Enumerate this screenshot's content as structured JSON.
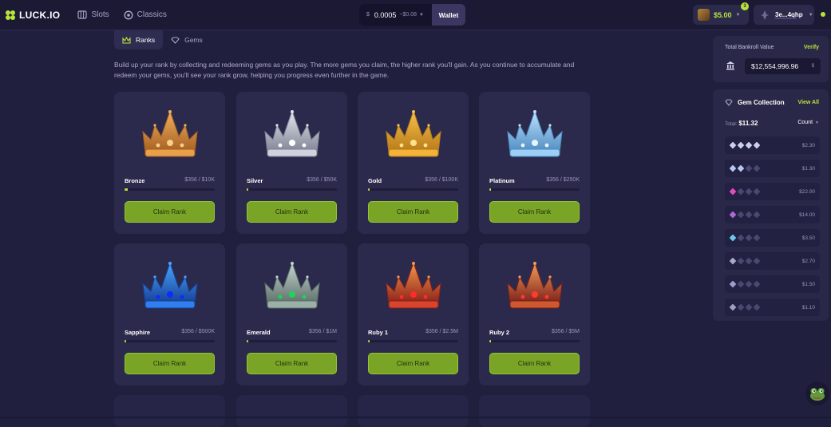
{
  "brand": {
    "name": "LUCK.IO",
    "accent": "#b8e33b"
  },
  "nav": {
    "slots": "Slots",
    "classics": "Classics"
  },
  "wallet": {
    "currency": "$",
    "balance": "0.0005",
    "delta": "~$0.08",
    "button": "Wallet"
  },
  "header": {
    "balance": "$5.00",
    "notifications": "3",
    "username": "3e...4qhp"
  },
  "tabs": [
    {
      "label": "Ranks",
      "active": true
    },
    {
      "label": "Gems",
      "active": false
    }
  ],
  "intro": "Build up your rank by collecting and redeeming gems as you play. The more gems you claim, the higher rank you'll gain. As you continue to accumulate and redeem your gems, you'll see your rank grow, helping you progress even further in the game.",
  "ranks": [
    {
      "name": "Bronze",
      "progress": "$356 / $10K",
      "fraction": 0.036,
      "color": "bronze",
      "claim": "Claim Rank"
    },
    {
      "name": "Silver",
      "progress": "$356 / $50K",
      "fraction": 0.007,
      "color": "silver",
      "claim": "Claim Rank"
    },
    {
      "name": "Gold",
      "progress": "$356 / $100K",
      "fraction": 0.004,
      "color": "gold",
      "claim": "Claim Rank"
    },
    {
      "name": "Platinum",
      "progress": "$356 / $250K",
      "fraction": 0.001,
      "color": "platinum",
      "claim": "Claim Rank"
    },
    {
      "name": "Sapphire",
      "progress": "$356 / $500K",
      "fraction": 0.001,
      "color": "sapphire",
      "claim": "Claim Rank"
    },
    {
      "name": "Emerald",
      "progress": "$356 / $1M",
      "fraction": 0.0004,
      "color": "emerald",
      "claim": "Claim Rank"
    },
    {
      "name": "Ruby 1",
      "progress": "$356 / $2.5M",
      "fraction": 0.0001,
      "color": "ruby",
      "claim": "Claim Rank"
    },
    {
      "name": "Ruby 2",
      "progress": "$356 / $5M",
      "fraction": 0.0001,
      "color": "ruby2",
      "claim": "Claim Rank"
    }
  ],
  "bankroll": {
    "label": "Total Bankroll Value",
    "verify": "Verify",
    "value": "$12,554,996.96",
    "currency": "$"
  },
  "gem_collection": {
    "title": "Gem Collection",
    "view_all": "View All",
    "total_label": "Total:",
    "total": "$11.32",
    "sort": "Count",
    "rows": [
      {
        "value": "$2.30",
        "gem_color": "#c9d0ee",
        "owned": 4
      },
      {
        "value": "$1.30",
        "gem_color": "#b7c6ee",
        "owned": 2
      },
      {
        "value": "$22.00",
        "gem_color": "#e24cc0",
        "owned": 1
      },
      {
        "value": "$14.00",
        "gem_color": "#b068d8",
        "owned": 1
      },
      {
        "value": "$3.50",
        "gem_color": "#6ec8ee",
        "owned": 1
      },
      {
        "value": "$2.70",
        "gem_color": "#a7a9c6",
        "owned": 1
      },
      {
        "value": "$1.50",
        "gem_color": "#9aa0c9",
        "owned": 1
      },
      {
        "value": "$1.10",
        "gem_color": "#9ea2c2",
        "owned": 1
      }
    ]
  }
}
